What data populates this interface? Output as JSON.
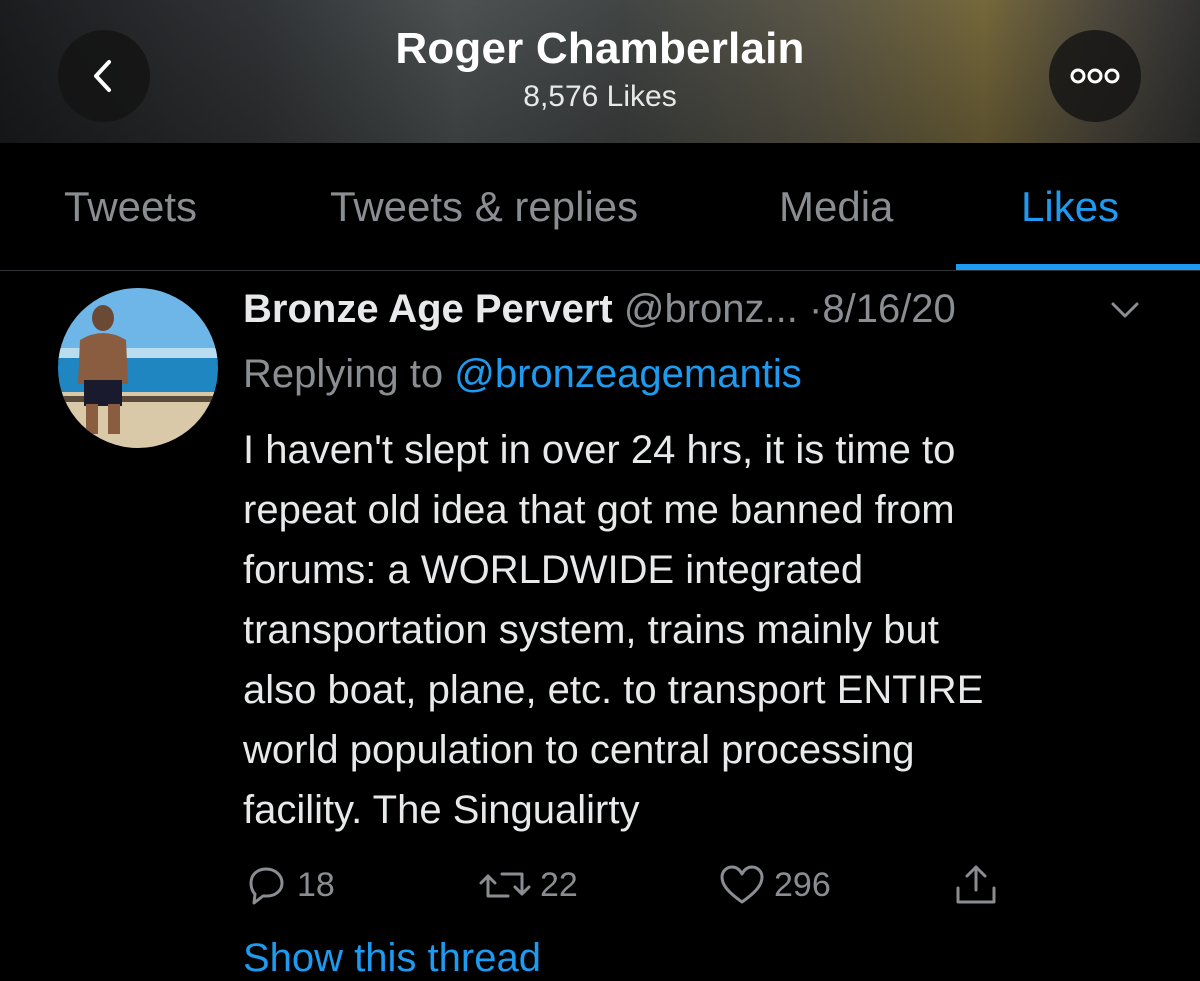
{
  "header": {
    "title": "Roger Chamberlain",
    "subtitle": "8,576 Likes",
    "back_icon": "chevron-left-icon",
    "more_icon": "more-horizontal-icon"
  },
  "tabs": [
    {
      "label": "Tweets",
      "active": false
    },
    {
      "label": "Tweets & replies",
      "active": false
    },
    {
      "label": "Media",
      "active": false
    },
    {
      "label": "Likes",
      "active": true
    }
  ],
  "tweet": {
    "author_name": "Bronze Age Pervert",
    "handle": "@bronz...",
    "separator": "·",
    "date": "8/16/20",
    "replying_prefix": "Replying to",
    "replying_handle": "@bronzeagemantis",
    "text_lines": [
      "I haven't slept in over 24 hrs, it is time to",
      "repeat old idea that got me banned from",
      "forums: a WORLDWIDE integrated",
      "transportation system, trains mainly but",
      "also boat, plane, etc. to transport ENTIRE",
      "world population to central processing",
      "facility. The Singualirty"
    ],
    "actions": {
      "replies": "18",
      "retweets": "22",
      "likes": "296"
    },
    "show_thread": "Show this thread"
  },
  "colors": {
    "accent": "#1d9bf0",
    "muted": "#8a8d91",
    "background": "#000000"
  }
}
